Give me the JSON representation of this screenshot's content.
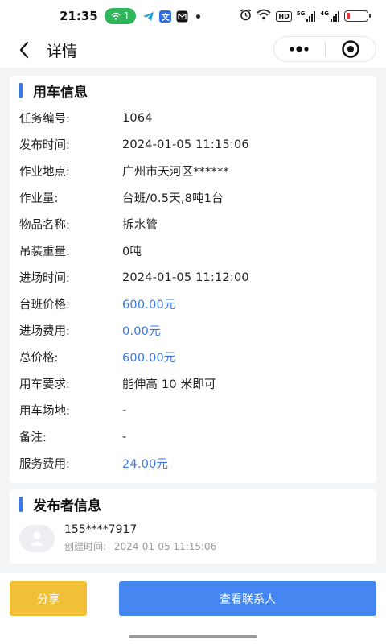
{
  "status_bar": {
    "time": "21:35",
    "pill_count": "1",
    "hd_label": "HD",
    "sig1_label": "5G",
    "sig2_label": "4G",
    "battery_level": 0.15
  },
  "nav": {
    "title": "详情"
  },
  "vehicle_info": {
    "title": "用车信息",
    "rows": [
      {
        "label": "任务编号:",
        "value": "1064"
      },
      {
        "label": "发布时间:",
        "value": "2024-01-05 11:15:06"
      },
      {
        "label": "作业地点:",
        "value": "广州市天河区******"
      },
      {
        "label": "作业量:",
        "value": "台班/0.5天,8吨1台"
      },
      {
        "label": "物品名称:",
        "value": "拆水管"
      },
      {
        "label": "吊装重量:",
        "value": "0吨"
      },
      {
        "label": "进场时间:",
        "value": "2024-01-05 11:12:00"
      },
      {
        "label": "台班价格:",
        "value": "600.00元"
      },
      {
        "label": "进场费用:",
        "value": "0.00元"
      },
      {
        "label": "总价格:",
        "value": "600.00元"
      },
      {
        "label": "用车要求:",
        "value": "能伸高 10 米即可"
      },
      {
        "label": "用车场地:",
        "value": "-"
      },
      {
        "label": "备注:",
        "value": "-"
      },
      {
        "label": "服务费用:",
        "value": "24.00元"
      }
    ]
  },
  "publisher": {
    "title": "发布者信息",
    "phone": "155****7917",
    "created_label": "创建时间:",
    "created_time": "2024-01-05 11:15:06"
  },
  "actions": {
    "share_label": "分享",
    "contact_label": "查看联系人"
  },
  "colors": {
    "accent": "#3a78e6",
    "share_button": "#f2c037",
    "contact_button": "#4586f0"
  }
}
